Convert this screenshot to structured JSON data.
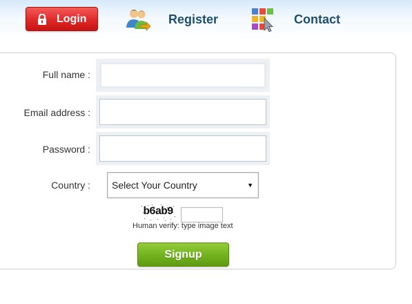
{
  "nav": {
    "login_label": "Login",
    "register_label": "Register",
    "contact_label": "Contact"
  },
  "form": {
    "fullname_label": "Full name :",
    "fullname_value": "",
    "email_label": "Email address :",
    "email_value": "",
    "password_label": "Password :",
    "password_value": "",
    "country_label": "Country :",
    "country_selected": "Select Your Country",
    "captcha_text": "b6ab9",
    "captcha_value": "",
    "captcha_help": "Human verify: type image text",
    "signup_label": "Signup"
  },
  "colors": {
    "login_button": "#e02828",
    "nav_text": "#1e4e6e",
    "signup_button": "#72b21e"
  },
  "icons": {
    "login": "lock-icon",
    "register": "users-icon",
    "contact": "color-grid-cursor-icon",
    "select": "chevron-down-icon"
  }
}
